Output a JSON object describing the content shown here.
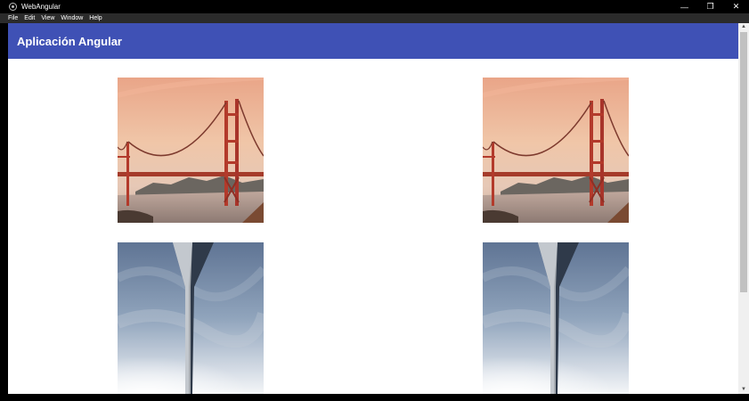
{
  "window": {
    "title": "WebAngular",
    "app_icon": "electron-icon",
    "controls": {
      "minimize": "—",
      "restore": "❐",
      "close": "✕"
    }
  },
  "menu": {
    "items": [
      "File",
      "Edit",
      "View",
      "Window",
      "Help"
    ]
  },
  "toolbar": {
    "title": "Aplicación Angular",
    "color": "#3f51b5"
  },
  "gallery": {
    "images": [
      {
        "subject": "golden-gate-bridge"
      },
      {
        "subject": "golden-gate-bridge"
      },
      {
        "subject": "tower-sky"
      },
      {
        "subject": "tower-sky"
      }
    ]
  },
  "scrollbar": {
    "up": "▲",
    "down": "▼"
  }
}
